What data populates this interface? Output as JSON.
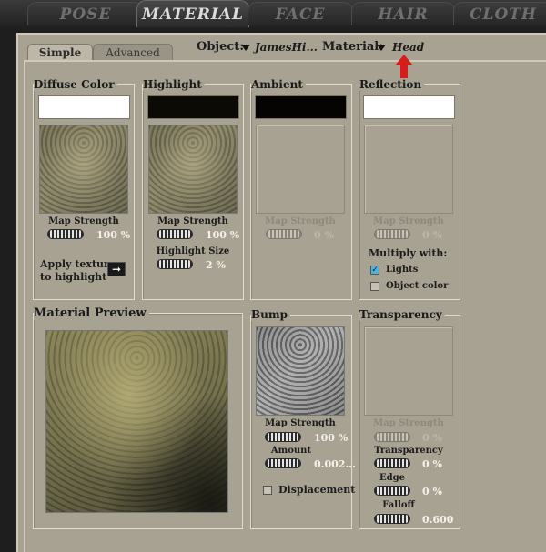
{
  "tabs": [
    {
      "label": "POSE",
      "active": false
    },
    {
      "label": "MATERIAL",
      "active": true
    },
    {
      "label": "FACE",
      "active": false
    },
    {
      "label": "HAIR",
      "active": false
    },
    {
      "label": "CLOTH",
      "active": false
    }
  ],
  "subtabs": {
    "simple": "Simple",
    "advanced": "Advanced"
  },
  "object": {
    "label": "Object:",
    "value": "JamesHi..."
  },
  "material": {
    "label": "Material:",
    "value": "Head"
  },
  "diffuse": {
    "title": "Diffuse Color",
    "color": "#ffffff",
    "map_label": "Map Strength",
    "map_value": "100 %",
    "apply_label_1": "Apply texture",
    "apply_label_2": "to highlight",
    "arrow": "➞"
  },
  "highlight": {
    "title": "Highlight",
    "color": "#0c0a05",
    "map_label": "Map Strength",
    "map_value": "100 %",
    "size_label": "Highlight Size",
    "size_value": "2 %"
  },
  "ambient": {
    "title": "Ambient",
    "color": "#050403",
    "map_label": "Map Strength",
    "map_value": "0 %"
  },
  "reflection": {
    "title": "Reflection",
    "color": "#ffffff",
    "map_label": "Map Strength",
    "map_value": "0 %",
    "multiply_label": "Multiply with:",
    "lights_label": "Lights",
    "lights_checked": true,
    "object_color_label": "Object color",
    "object_color_checked": false
  },
  "preview": {
    "title": "Material Preview"
  },
  "bump": {
    "title": "Bump",
    "map_label": "Map Strength",
    "map_value": "100 %",
    "amount_label": "Amount",
    "amount_value": "0.002...",
    "displacement_label": "Displacement",
    "displacement_checked": false
  },
  "transparency": {
    "title": "Transparency",
    "map_label": "Map Strength",
    "map_value": "0 %",
    "transparency_label": "Transparency",
    "transparency_value": "0 %",
    "edge_label": "Edge",
    "edge_value": "0 %",
    "falloff_label": "Falloff",
    "falloff_value": "0.600"
  },
  "colors": {
    "panel": "#a8a293",
    "indicator_arrow": "#d81b1b",
    "checkbox_on": "#4fb3d9"
  }
}
